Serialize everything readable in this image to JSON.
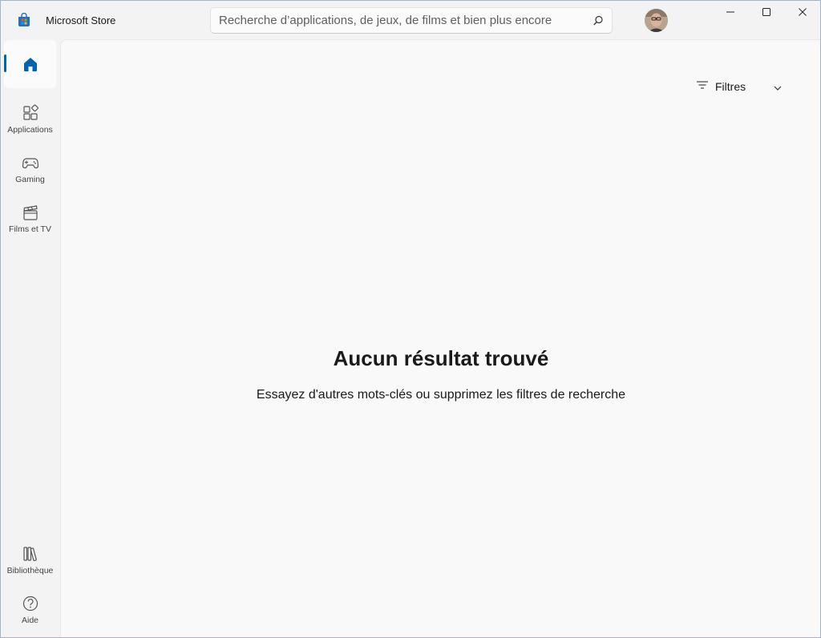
{
  "titlebar": {
    "app_title": "Microsoft Store",
    "app_icon": "store-icon",
    "avatar_icon": "user-avatar"
  },
  "search": {
    "placeholder": "Recherche d’applications, de jeux, de films et bien plus encore",
    "value": ""
  },
  "window_controls": {
    "minimize": "minimize-icon",
    "maximize": "maximize-icon",
    "close": "close-icon"
  },
  "sidebar": {
    "items": [
      {
        "label": "",
        "icon": "home-icon",
        "active": true
      },
      {
        "label": "Applications",
        "icon": "apps-icon",
        "active": false
      },
      {
        "label": "Gaming",
        "icon": "gamepad-icon",
        "active": false
      },
      {
        "label": "Films et TV",
        "icon": "clapperboard-icon",
        "active": false
      }
    ],
    "bottom_items": [
      {
        "label": "Bibliothèque",
        "icon": "library-icon"
      },
      {
        "label": "Aide",
        "icon": "help-icon"
      }
    ]
  },
  "main": {
    "filters_label": "Filtres",
    "empty_title": "Aucun résultat trouvé",
    "empty_subtitle": "Essayez d'autres mots-clés ou supprimez les filtres de recherche"
  },
  "colors": {
    "accent": "#0063b1",
    "background": "#f3f3f3",
    "content_background": "#f9f9f9"
  }
}
